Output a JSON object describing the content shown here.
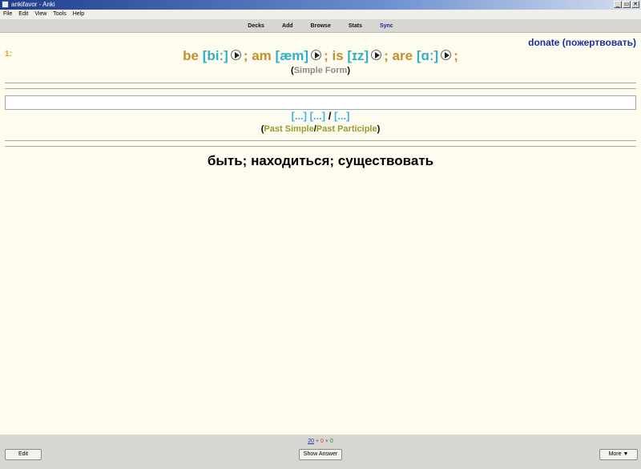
{
  "window": {
    "title": "ankifavor - Anki",
    "buttons": [
      "_",
      "▭",
      "✕"
    ]
  },
  "menu": [
    "File",
    "Edit",
    "View",
    "Tools",
    "Help"
  ],
  "toolbar": {
    "decks": "Decks",
    "add": "Add",
    "browse": "Browse",
    "stats": "Stats",
    "sync": "Sync"
  },
  "card": {
    "donate": "donate (пожертвовать)",
    "number": "1:",
    "forms": [
      {
        "word": "be",
        "pron": "[biː]"
      },
      {
        "word": "am",
        "pron": "[æm]"
      },
      {
        "word": "is",
        "pron": "[ɪz]"
      },
      {
        "word": "are",
        "pron": "[ɑː]"
      }
    ],
    "form_note": {
      "open": "(",
      "label": "Simple Form",
      "close": ")"
    },
    "cloze": {
      "a": "[...]",
      "b": "[...]",
      "sep": "/",
      "c": "[...]"
    },
    "past_note": {
      "open": "(",
      "simple": "Past Simple",
      "sep": "/",
      "participle": "Past Participle",
      "close": ")"
    },
    "translation": "быть; находиться; существовать"
  },
  "bottom": {
    "counts": {
      "new": "20",
      "plus1": "+",
      "learn": "0",
      "plus2": "+",
      "review": "0"
    },
    "edit": "Edit",
    "show_answer": "Show Answer",
    "more": "More ▼"
  }
}
